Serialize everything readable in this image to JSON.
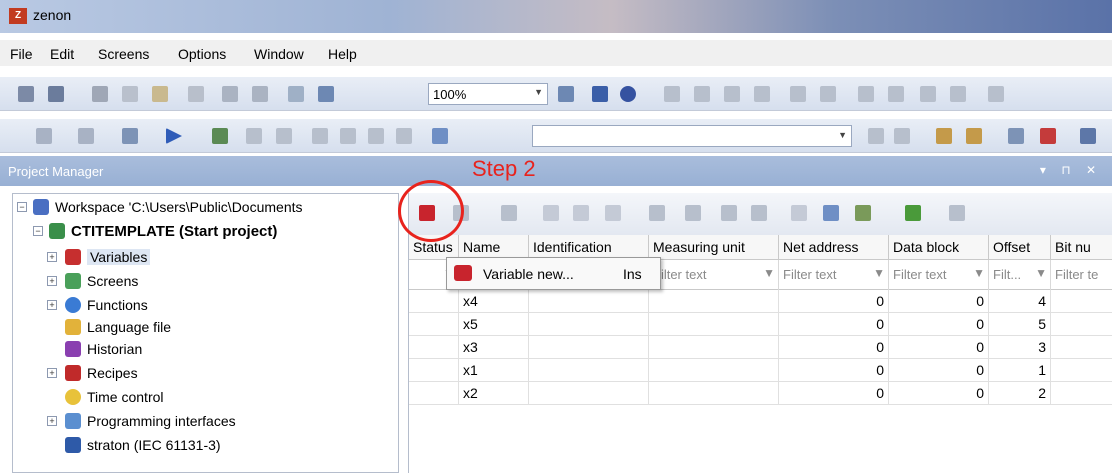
{
  "window": {
    "title": "zenon",
    "logo_text": "Z"
  },
  "menu": [
    "File",
    "Edit",
    "Screens",
    "Options",
    "Window",
    "Help"
  ],
  "toolbar": {
    "zoom_value": "100%"
  },
  "project_manager": {
    "title": "Project Manager",
    "controls": "▾ ⊓ ✕"
  },
  "annotation": {
    "step_label": "Step 2"
  },
  "tree": {
    "workspace": "Workspace 'C:\\Users\\Public\\Documents",
    "project": "CTITEMPLATE (Start project)",
    "items": [
      "Variables",
      "Screens",
      "Functions",
      "Language file",
      "Historian",
      "Recipes",
      "Time control",
      "Programming interfaces",
      "straton (IEC 61131-3)"
    ]
  },
  "grid": {
    "columns": [
      "Status",
      "Name",
      "Identification",
      "Measuring unit",
      "Net address",
      "Data block",
      "Offset",
      "Bit nu"
    ],
    "filters": [
      "",
      "",
      "",
      "Filter text",
      "Filter text",
      "Filter text",
      "Filt...",
      "Filter te"
    ],
    "rows": [
      {
        "name": "x4",
        "net": "0",
        "block": "0",
        "offset": "4"
      },
      {
        "name": "x5",
        "net": "0",
        "block": "0",
        "offset": "5"
      },
      {
        "name": "x3",
        "net": "0",
        "block": "0",
        "offset": "3"
      },
      {
        "name": "x1",
        "net": "0",
        "block": "0",
        "offset": "1"
      },
      {
        "name": "x2",
        "net": "0",
        "block": "0",
        "offset": "2"
      }
    ]
  },
  "tooltip": {
    "label": "Variable new...",
    "shortcut": "Ins"
  }
}
